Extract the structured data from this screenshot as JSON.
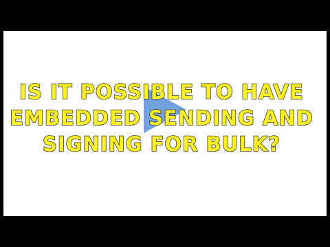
{
  "video": {
    "title": "Is it possible to have embedded sending and signing for bulk?",
    "play_icon": "play-icon",
    "colors": {
      "background": "#000000",
      "card": "#ffffff",
      "title_text": "#fdf028",
      "title_outline": "#3c3c14",
      "play_button": "#5a8fd8"
    }
  }
}
